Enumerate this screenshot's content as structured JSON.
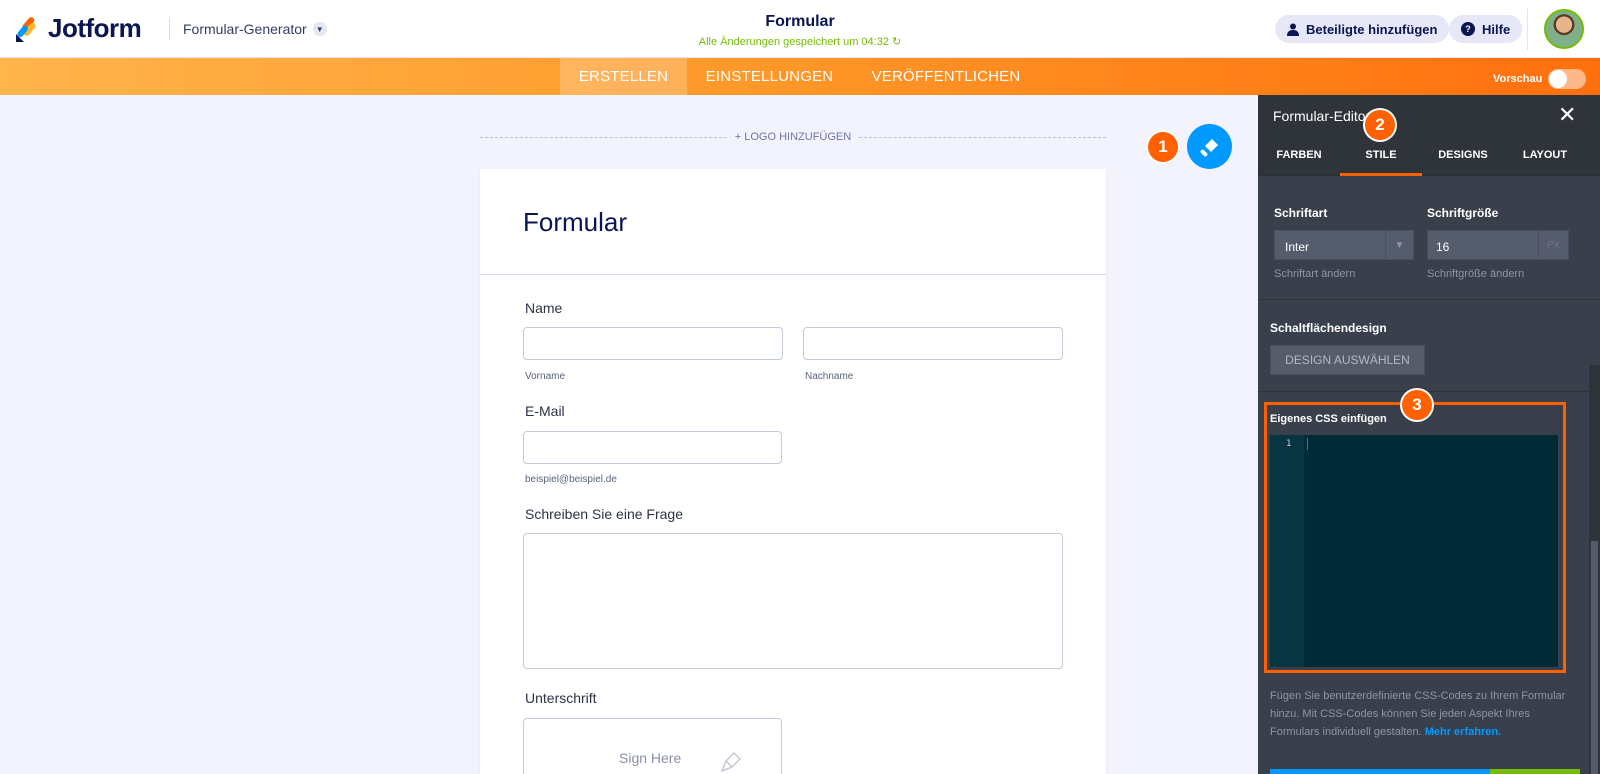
{
  "header": {
    "brand": "Jotform",
    "generator_menu": "Formular-Generator",
    "form_title": "Formular",
    "saved_status": "Alle Änderungen gespeichert um 04:32",
    "invite_label": "Beteiligte hinzufügen",
    "help_label": "Hilfe"
  },
  "nav": {
    "tabs": [
      "ERSTELLEN",
      "EINSTELLUNGEN",
      "VERÖFFENTLICHEN"
    ],
    "active_tab": "ERSTELLEN",
    "preview_label": "Vorschau",
    "preview_on": false
  },
  "canvas": {
    "add_logo": "+ LOGO HINZUFÜGEN",
    "heading": "Formular",
    "fields": {
      "name_label": "Name",
      "first_sublabel": "Vorname",
      "last_sublabel": "Nachname",
      "email_label": "E-Mail",
      "email_sublabel": "beispiel@beispiel.de",
      "question_label": "Schreiben Sie eine Frage",
      "signature_label": "Unterschrift",
      "signature_placeholder": "Sign Here"
    }
  },
  "badges": [
    "1",
    "2",
    "3"
  ],
  "panel": {
    "title": "Formular-Editor",
    "tabs": [
      "FARBEN",
      "STILE",
      "DESIGNS",
      "LAYOUT"
    ],
    "active_tab": "STILE",
    "font_label": "Schriftart",
    "font_value": "Inter",
    "font_hint": "Schriftart ändern",
    "size_label": "Schriftgröße",
    "size_value": "16",
    "size_unit": "PX",
    "size_hint": "Schriftgröße ändern",
    "button_design_label": "Schaltflächendesign",
    "button_design_btn": "DESIGN AUSWÄHLEN",
    "css_label": "Eigenes CSS einfügen",
    "css_line_number": "1",
    "css_description": "Fügen Sie benutzerdefinierte CSS-Codes zu Ihrem Formular hinzu. Mit CSS-Codes können Sie jeden Aspekt Ihres Formulars individuell gestalten.",
    "learn_more": "Mehr erfahren."
  },
  "colors": {
    "brand_orange": "#ff6100",
    "brand_blue": "#0099ff",
    "navy": "#0a1551",
    "saved_green": "#78bb07"
  }
}
